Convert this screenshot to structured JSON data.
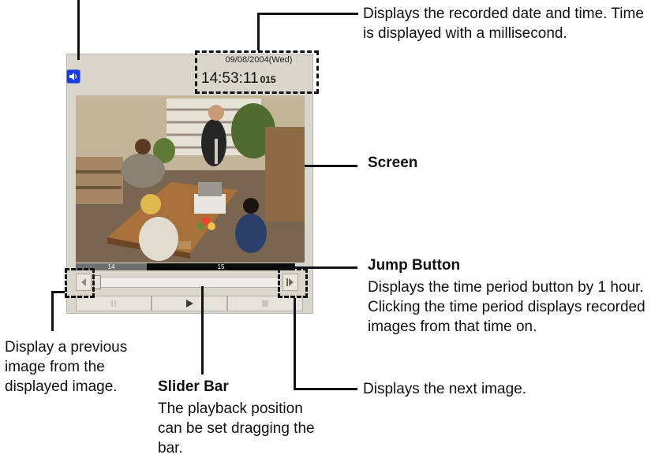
{
  "viewer": {
    "date": "09/08/2004(Wed)",
    "time": "14:53:11",
    "milliseconds": "015",
    "hour_labels": [
      "14",
      "15"
    ],
    "icons": {
      "speaker": "speaker-icon",
      "prev": "triangle-left-icon",
      "next": "triangle-right-bar-icon",
      "pause": "pause-icon",
      "play": "play-icon",
      "stop": "stop-icon"
    }
  },
  "annotations": {
    "datetime": "Displays the recorded date and time. Time is displayed with a millisecond.",
    "screen_title": "Screen",
    "jump_title": "Jump Button",
    "jump_desc": "Displays the time period button by 1 hour. Clicking the time period displays recorded images from that time on.",
    "prev_desc": "Display a previous image from the displayed image.",
    "slider_title": "Slider Bar",
    "slider_desc": "The playback position can be set dragging the bar.",
    "next_desc": "Displays the next image."
  }
}
